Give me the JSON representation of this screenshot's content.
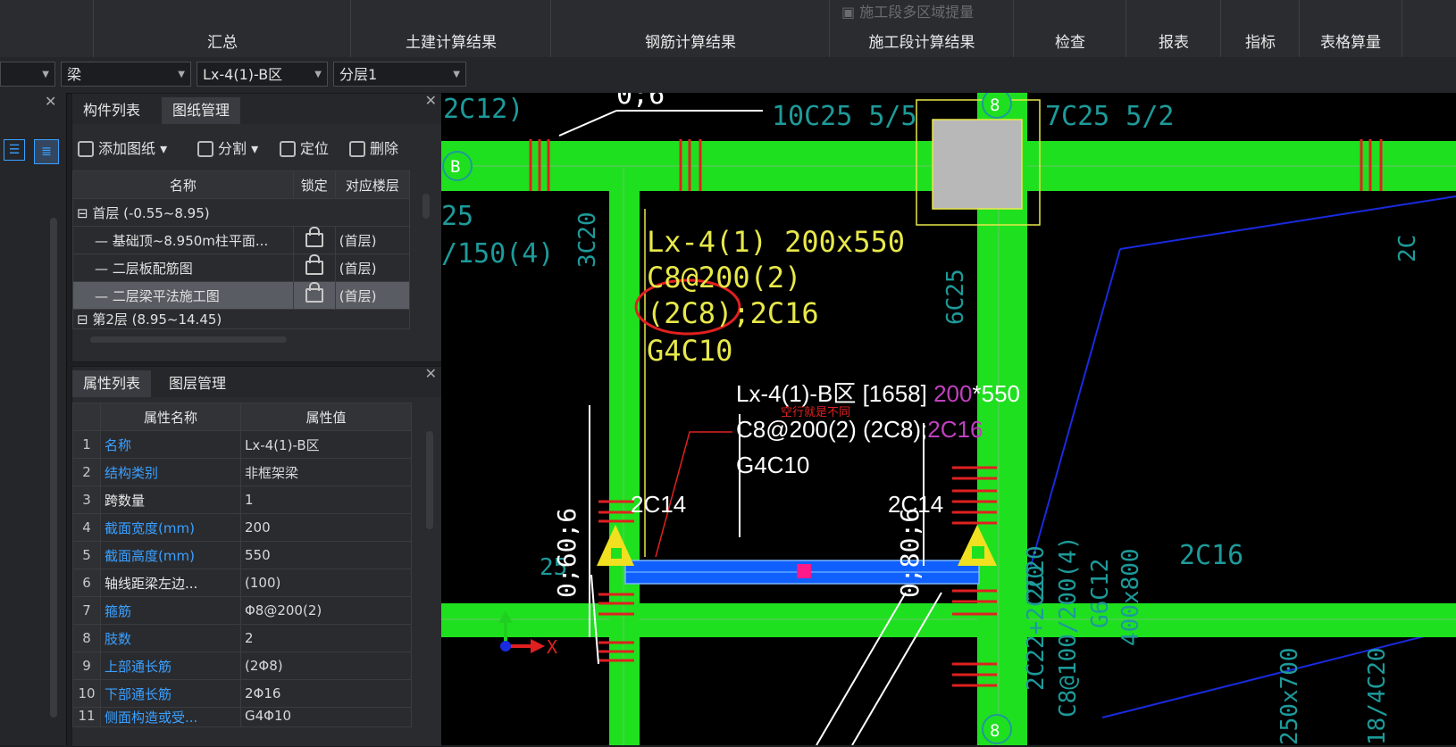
{
  "ribbon": {
    "groups": [
      "汇总",
      "土建计算结果",
      "钢筋计算结果",
      "施工段计算结果",
      "检查",
      "报表",
      "指标",
      "表格算量"
    ],
    "faint_item": "施工段多区域提量"
  },
  "combos": {
    "type": "梁",
    "component": "Lx-4(1)-B区",
    "layer": "分层1"
  },
  "drawing_panel": {
    "tabs": [
      "构件列表",
      "图纸管理"
    ],
    "toolbar": [
      "添加图纸",
      "分割",
      "定位",
      "删除"
    ],
    "columns": [
      "名称",
      "锁定",
      "对应楼层"
    ],
    "rows": [
      {
        "name": "首层 (-0.55~8.95)",
        "floor": ""
      },
      {
        "name": "基础顶~8.950m柱平面...",
        "floor": "(首层)"
      },
      {
        "name": "二层板配筋图",
        "floor": "(首层)"
      },
      {
        "name": "二层梁平法施工图",
        "floor": "(首层)"
      },
      {
        "name": "第2层 (8.95~14.45)",
        "floor": ""
      }
    ]
  },
  "prop_panel": {
    "tabs": [
      "属性列表",
      "图层管理"
    ],
    "columns": [
      "属性名称",
      "属性值"
    ],
    "rows": [
      {
        "n": "1",
        "name": "名称",
        "value": "Lx-4(1)-B区"
      },
      {
        "n": "2",
        "name": "结构类别",
        "value": "非框架梁"
      },
      {
        "n": "3",
        "name": "跨数量",
        "value": "1"
      },
      {
        "n": "4",
        "name": "截面宽度(mm)",
        "value": "200"
      },
      {
        "n": "5",
        "name": "截面高度(mm)",
        "value": "550"
      },
      {
        "n": "6",
        "name": "轴线距梁左边...",
        "value": "(100)"
      },
      {
        "n": "7",
        "name": "箍筋",
        "value": "Φ8@200(2)"
      },
      {
        "n": "8",
        "name": "肢数",
        "value": "2"
      },
      {
        "n": "9",
        "name": "上部通长筋",
        "value": "(2Φ8)"
      },
      {
        "n": "10",
        "name": "下部通长筋",
        "value": "2Φ16"
      },
      {
        "n": "11",
        "name": "侧面构造或受...",
        "value": "G4Φ10"
      }
    ]
  },
  "canvas": {
    "top_labels": [
      "2C12)",
      "0;6",
      "10C25 5/5",
      "7C25 5/2"
    ],
    "grid_labels": {
      "b": "B",
      "eight_top": "8",
      "eight_bottom": "8"
    },
    "yellow_text": [
      "Lx-4(1) 200x550",
      "C8@200(2)",
      "(2C8);2C16",
      "G4C10"
    ],
    "white_text": {
      "line1_a": "Lx-4(1)-B区 [1658] ",
      "line1_b": "200",
      "line1_c": "*550",
      "line2_a": "C8@200(2) (2C8);",
      "line2_b": "2C16",
      "line3": "G4C10"
    },
    "red_note": "空行就是不同",
    "bar_labels": [
      "2C14",
      "2C14"
    ],
    "dims": [
      "0;60;6",
      "0;80;6"
    ],
    "teal_left": [
      "25",
      "/150(4)",
      "3C20",
      "6C25",
      "25",
      "2C"
    ],
    "teal_right": [
      "2C20",
      "2C22+2C20",
      "C8@100/200(4)",
      "G6C12",
      "400x800",
      "2C16",
      "250x700",
      "18/4C20"
    ],
    "axis_x": "X",
    "colors": {
      "beam_green": "#1fe01f",
      "beam_blue": "#1060ff",
      "text_yellow": "#e8e84a",
      "text_teal": "#1e9a9a",
      "marker_red": "#e02020"
    }
  }
}
